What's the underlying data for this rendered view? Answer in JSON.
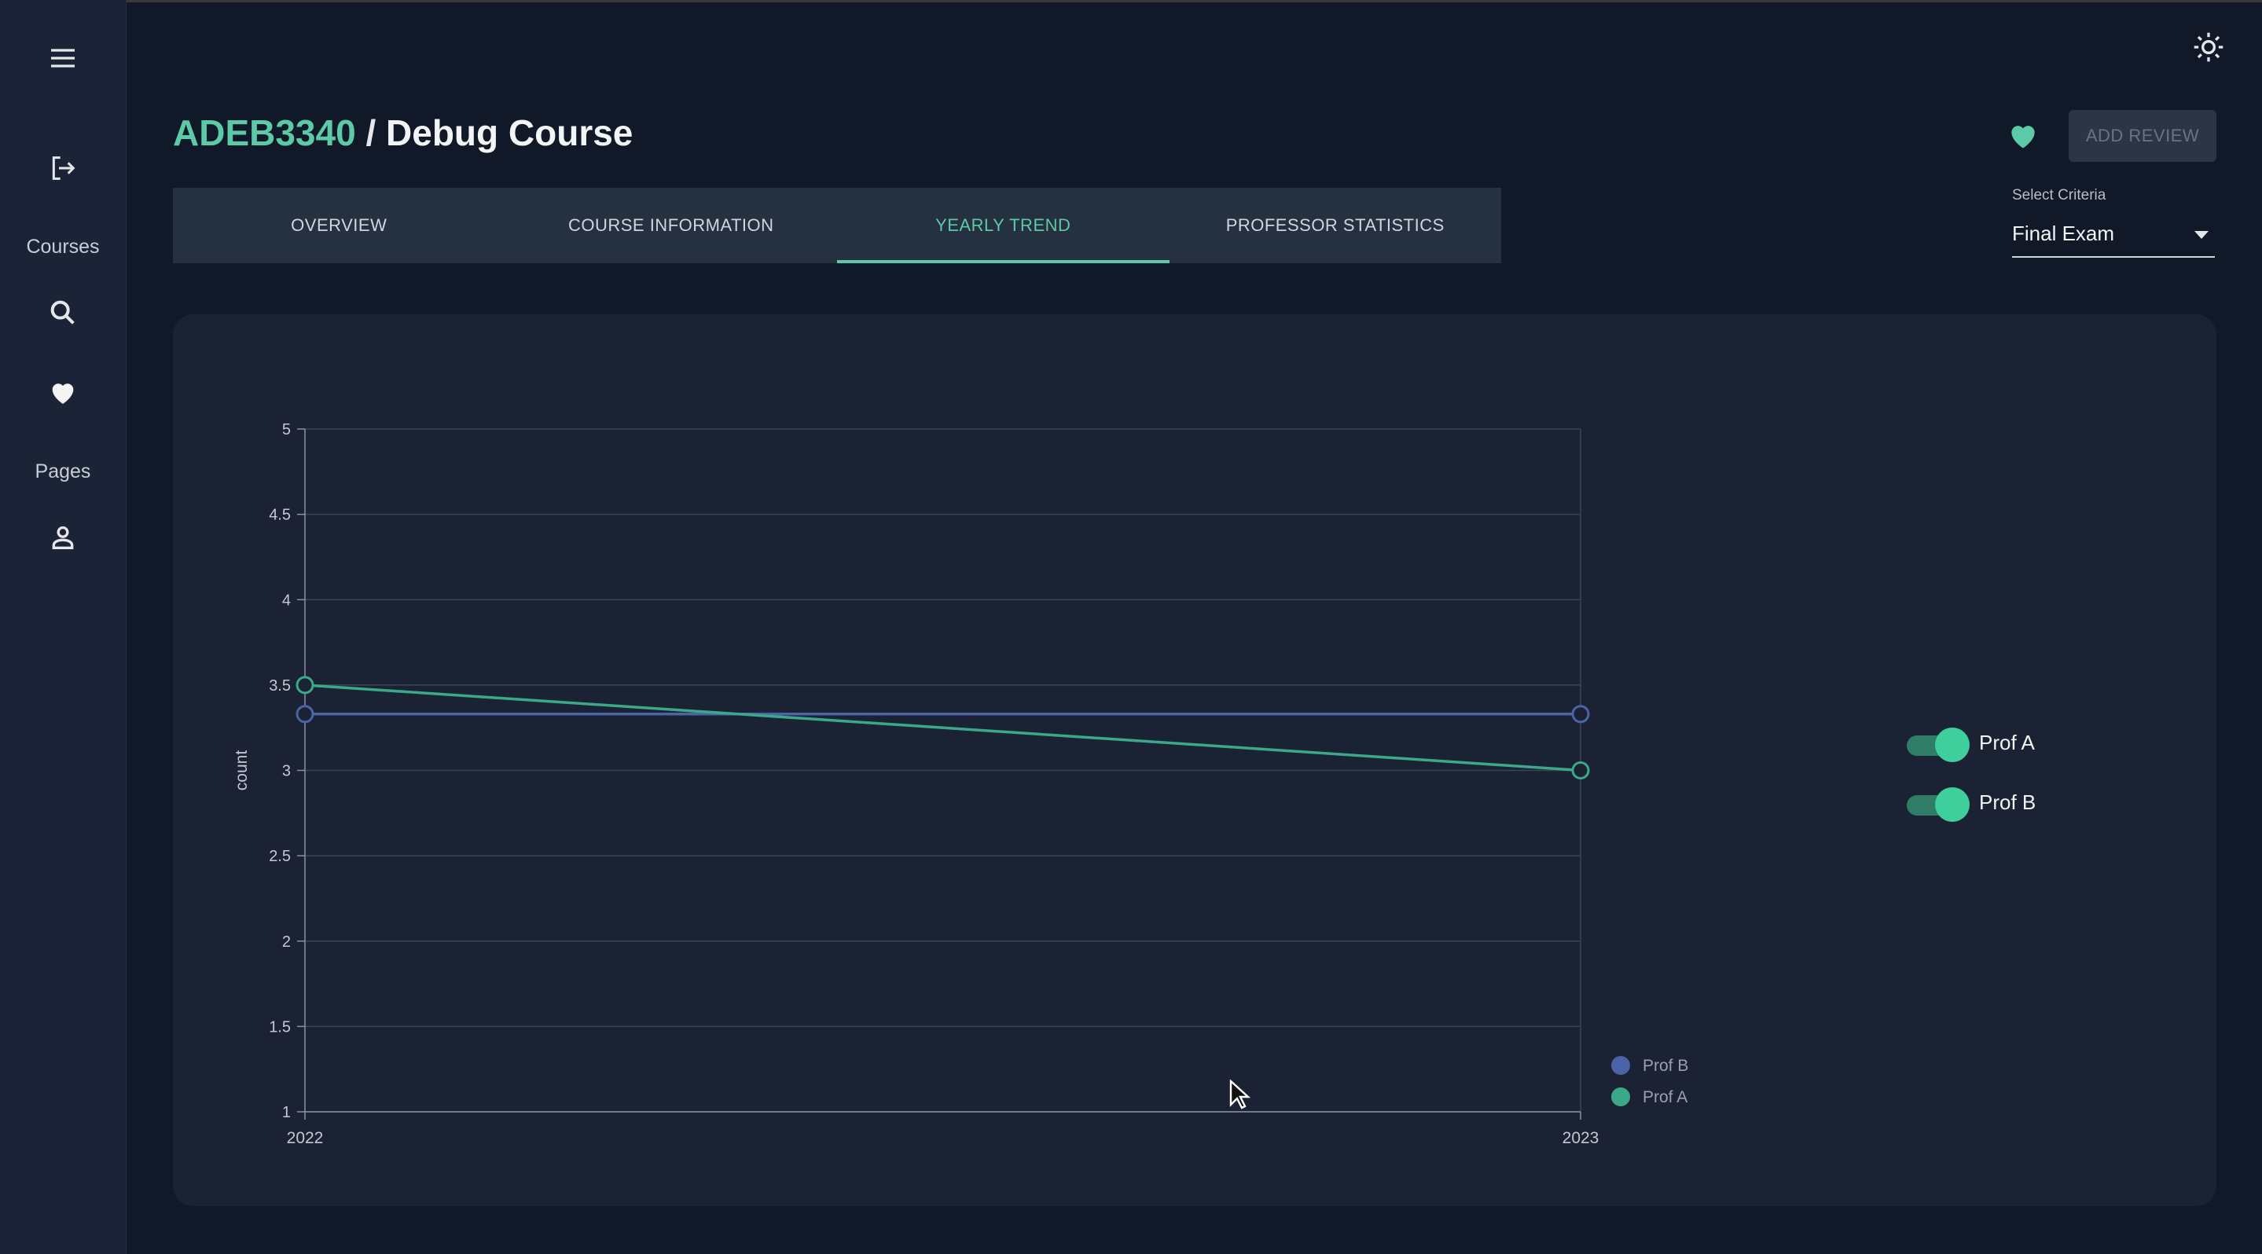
{
  "course": {
    "code": "ADEB3340",
    "separator": " / ",
    "name": "Debug Course"
  },
  "sidebar": {
    "courses_label": "Courses",
    "pages_label": "Pages"
  },
  "tabs": [
    {
      "label": "OVERVIEW",
      "active": false
    },
    {
      "label": "COURSE INFORMATION",
      "active": false
    },
    {
      "label": "YEARLY TREND",
      "active": true
    },
    {
      "label": "PROFESSOR STATISTICS",
      "active": false
    }
  ],
  "actions": {
    "add_review_label": "ADD REVIEW"
  },
  "criteria": {
    "label": "Select Criteria",
    "value": "Final Exam"
  },
  "toggles": [
    {
      "label": "Prof A",
      "on": true
    },
    {
      "label": "Prof B",
      "on": true
    }
  ],
  "colors": {
    "accent": "#5cc9a7",
    "prof_a": "#3ba889",
    "prof_b": "#4c63a8"
  },
  "chart_data": {
    "type": "line",
    "x": [
      "2022",
      "2023"
    ],
    "ylabel": "count",
    "ylim": [
      1,
      5
    ],
    "yticks": [
      "1",
      "1.5",
      "2",
      "2.5",
      "3",
      "3.5",
      "4",
      "4.5",
      "5"
    ],
    "grid": true,
    "legend_position": "bottom-right",
    "series": [
      {
        "name": "Prof B",
        "values": [
          3.33,
          3.33
        ]
      },
      {
        "name": "Prof A",
        "values": [
          3.5,
          3.0
        ]
      }
    ]
  }
}
